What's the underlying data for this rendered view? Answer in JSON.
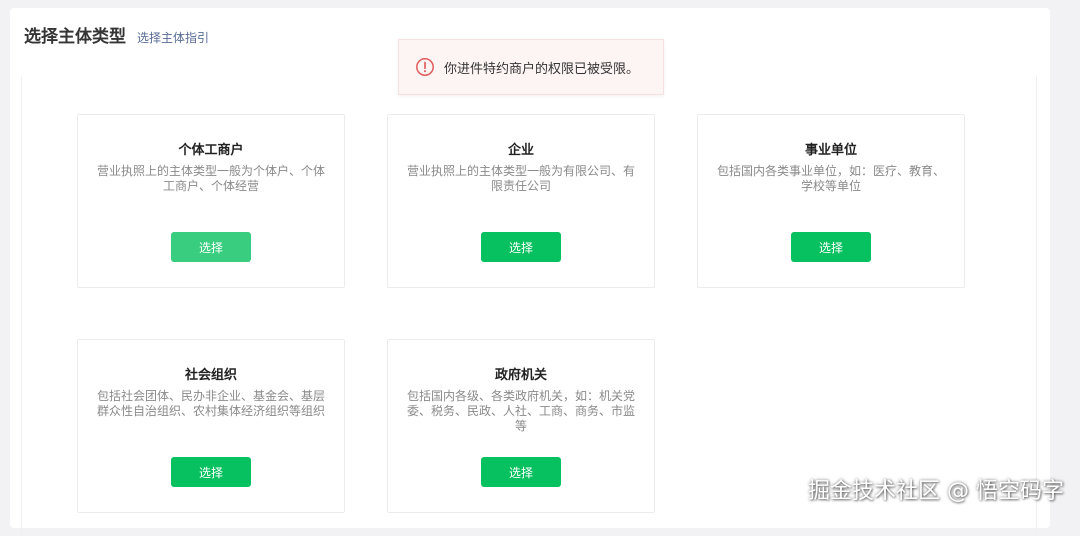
{
  "header": {
    "title": "选择主体类型",
    "guide_link": "选择主体指引"
  },
  "toast": {
    "icon": "error-circle-icon",
    "message": "你进件特约商户的权限已被受限。",
    "color": "#e15d5d"
  },
  "cards": [
    {
      "title": "个体工商户",
      "desc": "营业执照上的主体类型一般为个体户、个体工商户、个体经营",
      "button": "选择"
    },
    {
      "title": "企业",
      "desc": "营业执照上的主体类型一般为有限公司、有限责任公司",
      "button": "选择"
    },
    {
      "title": "事业单位",
      "desc": "包括国内各类事业单位，如：医疗、教育、学校等单位",
      "button": "选择"
    },
    {
      "title": "社会组织",
      "desc": "包括社会团体、民办非企业、基金会、基层群众性自治组织、农村集体经济组织等组织",
      "button": "选择"
    },
    {
      "title": "政府机关",
      "desc": "包括国内各级、各类政府机关，如：机关党委、税务、民政、人社、工商、商务、市监等",
      "button": "选择"
    }
  ],
  "colors": {
    "primary": "#07c160",
    "primary_hover": "#38cd7f",
    "link": "#576b95"
  },
  "watermark": "掘金技术社区 @ 悟空码字"
}
